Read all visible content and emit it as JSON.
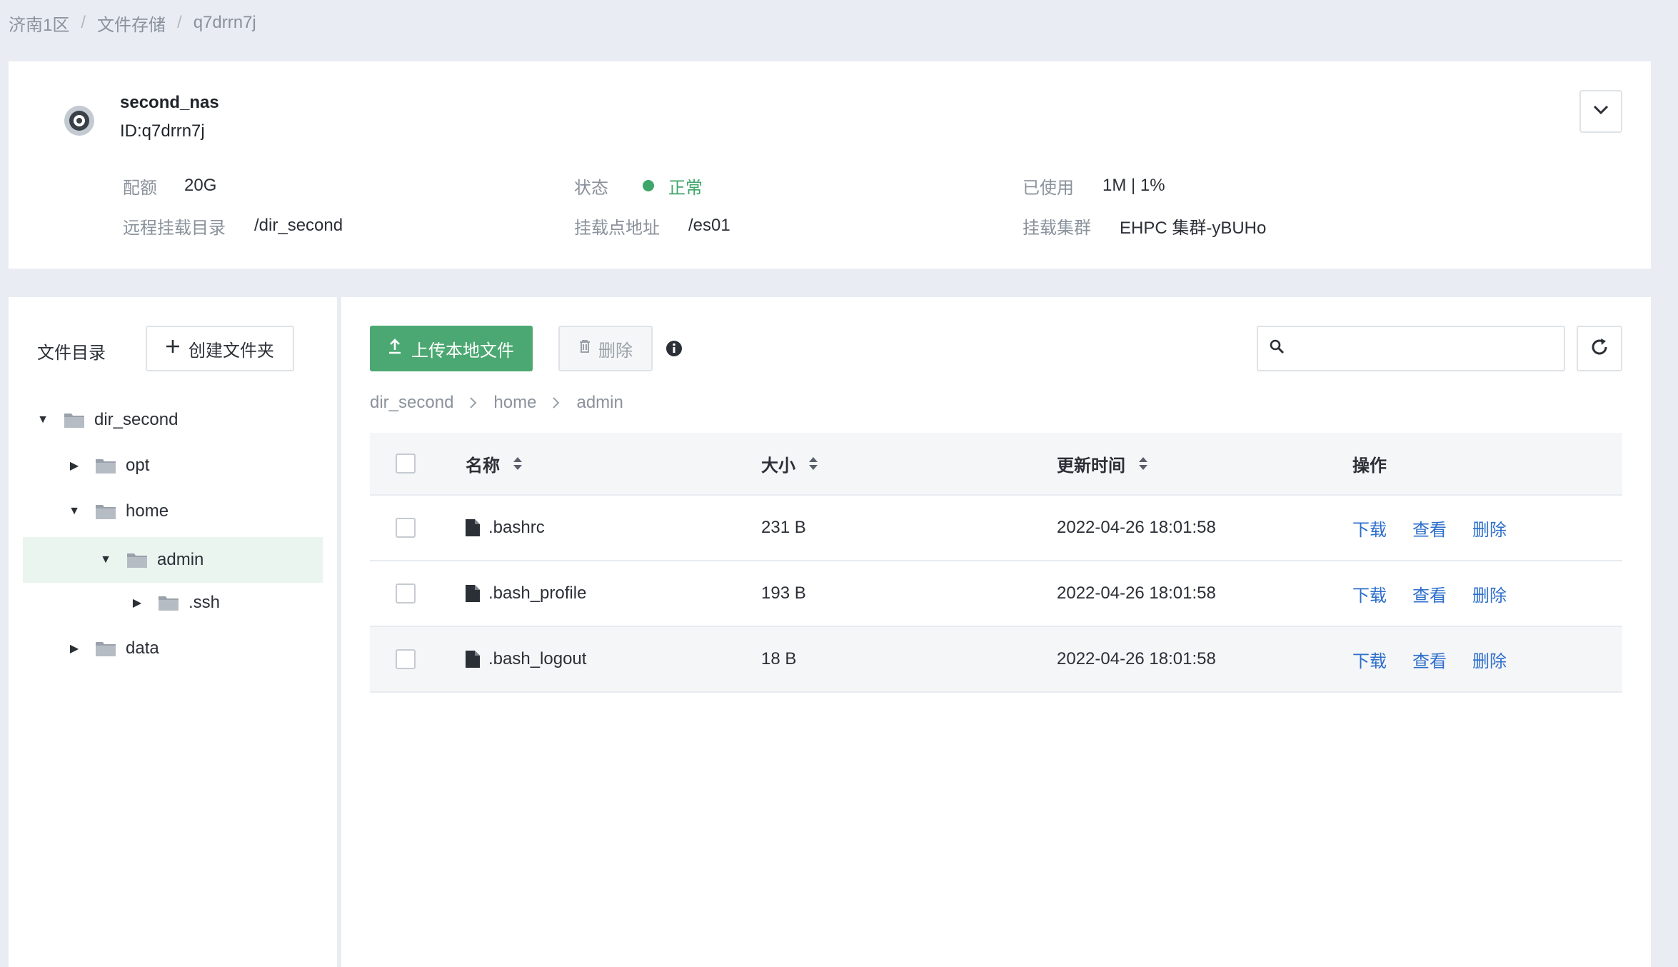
{
  "breadcrumb": [
    "济南1区",
    "文件存储",
    "q7drrn7j"
  ],
  "breadcrumb_sep": "/",
  "filesystem": {
    "name": "second_nas",
    "id": "ID:q7drrn7j",
    "fields": {
      "quota": {
        "label": "配额",
        "value": "20G"
      },
      "status": {
        "label": "状态",
        "value": "正常",
        "color": "#3fa66b"
      },
      "used": {
        "label": "已使用",
        "value": "1M | 1%"
      },
      "remote_dir": {
        "label": "远程挂载目录",
        "value": "/dir_second"
      },
      "mount_point": {
        "label": "挂载点地址",
        "value": "/es01"
      },
      "cluster": {
        "label": "挂载集群",
        "value": "EHPC 集群-yBUHo"
      }
    }
  },
  "tree": {
    "title": "文件目录",
    "create_label": "创建文件夹",
    "nodes": [
      {
        "label": "dir_second",
        "expanded": true
      },
      {
        "label": "opt",
        "expanded": false
      },
      {
        "label": "home",
        "expanded": true
      },
      {
        "label": "admin",
        "expanded": true,
        "selected": true
      },
      {
        "label": ".ssh",
        "expanded": false
      },
      {
        "label": "data",
        "expanded": false
      }
    ]
  },
  "toolbar": {
    "upload_label": "上传本地文件",
    "delete_label": "删除",
    "search_placeholder": ""
  },
  "path": [
    "dir_second",
    "home",
    "admin"
  ],
  "table": {
    "headers": {
      "name": "名称",
      "size": "大小",
      "time": "更新时间",
      "ops": "操作"
    },
    "rows": [
      {
        "name": ".bashrc",
        "size": "231 B",
        "time": "2022-04-26 18:01:58"
      },
      {
        "name": ".bash_profile",
        "size": "193 B",
        "time": "2022-04-26 18:01:58"
      },
      {
        "name": ".bash_logout",
        "size": "18 B",
        "time": "2022-04-26 18:01:58"
      }
    ],
    "ops": {
      "download": "下载",
      "view": "查看",
      "delete": "删除"
    }
  },
  "colors": {
    "accent_green": "#4ca872",
    "link_blue": "#2e6fcb",
    "page_bg": "#e9edf3"
  },
  "icons": [
    "disk-icon",
    "chevron-down-icon",
    "plus-icon",
    "caret-down-icon",
    "caret-right-icon",
    "folder-icon",
    "upload-icon",
    "trash-icon",
    "info-icon",
    "search-icon",
    "refresh-icon",
    "chevron-right-icon",
    "sort-icon",
    "file-icon"
  ]
}
